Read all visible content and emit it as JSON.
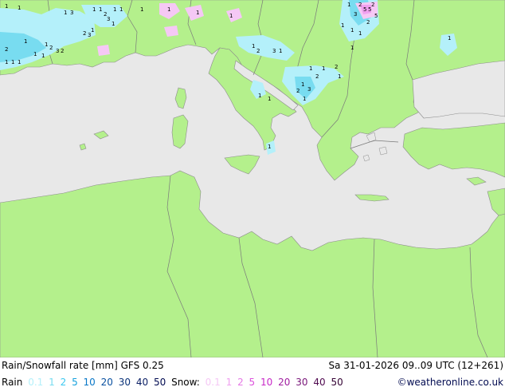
{
  "title": "Rain/Snowfall rate [mm] GFS 0.25",
  "datetime": "Sa 31-01-2026 09..09 UTC (12+261)",
  "credit": "©weatheronline.co.uk",
  "legend": {
    "rain_label": "Rain",
    "snow_label": "Snow:",
    "rain_items": [
      {
        "text": "0.1",
        "color": "#b4f0fa"
      },
      {
        "text": "1",
        "color": "#78dcf0"
      },
      {
        "text": "2",
        "color": "#3cc8f0"
      },
      {
        "text": "5",
        "color": "#14a0dc"
      },
      {
        "text": "10",
        "color": "#0a78c8"
      },
      {
        "text": "20",
        "color": "#0a50a0"
      },
      {
        "text": "30",
        "color": "#0a3278"
      },
      {
        "text": "40",
        "color": "#0a1e64"
      },
      {
        "text": "50",
        "color": "#000a50"
      }
    ],
    "snow_items": [
      {
        "text": "0.1",
        "color": "#f5c8f5"
      },
      {
        "text": "1",
        "color": "#f0a0f0"
      },
      {
        "text": "2",
        "color": "#e678e6"
      },
      {
        "text": "5",
        "color": "#dc50dc"
      },
      {
        "text": "10",
        "color": "#c828c8"
      },
      {
        "text": "20",
        "color": "#a01ea0"
      },
      {
        "text": "30",
        "color": "#781478"
      },
      {
        "text": "40",
        "color": "#500a50"
      },
      {
        "text": "50",
        "color": "#320032"
      }
    ]
  },
  "colors": {
    "sea": "#e8e8e8",
    "land": "#b4f08c",
    "border": "#7a7a7a",
    "coast": "#8c8c8c"
  },
  "map_labels": [
    "1",
    "1",
    "1",
    "1",
    "1",
    "1",
    "1",
    "1",
    "1",
    "1",
    "1",
    "1",
    "1",
    "1",
    "1",
    "1",
    "1",
    "1",
    "1",
    "1",
    "1",
    "1",
    "1",
    "1",
    "1",
    "1",
    "1",
    "1",
    "1",
    "1",
    "1",
    "1",
    "1",
    "1",
    "1",
    "1",
    "2",
    "2",
    "2",
    "2",
    "2",
    "2",
    "2",
    "2",
    "2",
    "2",
    "2",
    "2",
    "3",
    "3",
    "3",
    "3",
    "3",
    "3",
    "3",
    "5",
    "5",
    "5"
  ]
}
